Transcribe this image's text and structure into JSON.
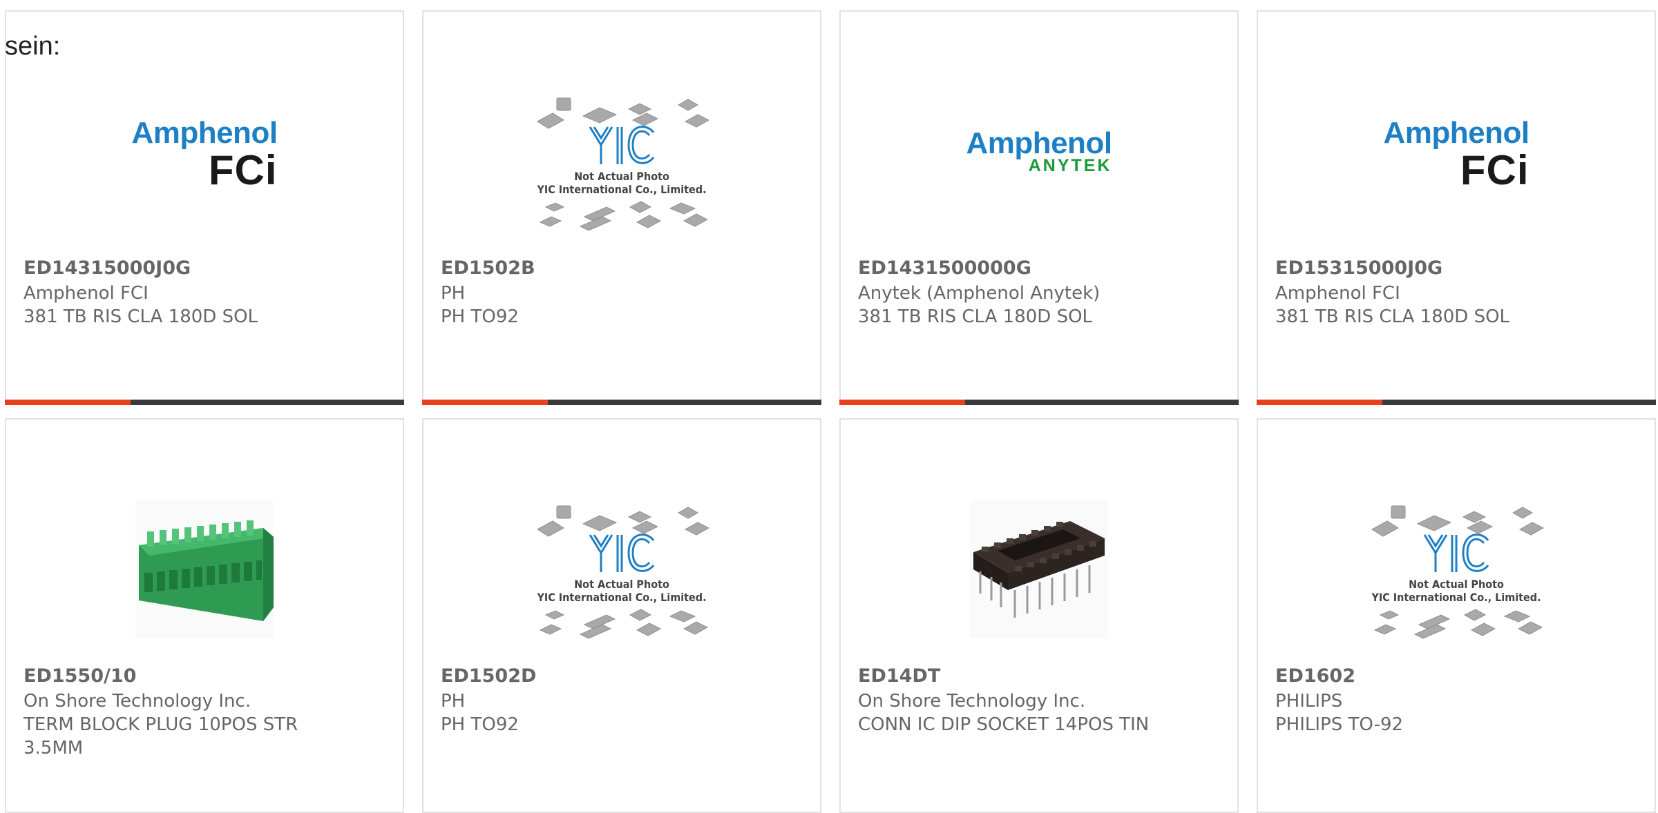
{
  "lead_text": "sein:",
  "colors": {
    "accent": "#e8401c",
    "bar": "#3a3a3a",
    "amphenol_blue": "#1d7fc4",
    "anytek_green": "#1a9a3a"
  },
  "logos": {
    "amphenol": "Amphenol",
    "fci": "FCi",
    "anytek": "ANYTEK"
  },
  "placeholder": {
    "line1": "Not Actual Photo",
    "line2": "YIC International Co., Limited.",
    "mark": "YIC"
  },
  "products": [
    {
      "part_number": "ED14315000J0G",
      "manufacturer": "Amphenol FCI",
      "description": "381 TB RIS CLA 180D SOL",
      "image": "amphenol-fci-logo"
    },
    {
      "part_number": "ED1502B",
      "manufacturer": "PH",
      "description": "PH TO92",
      "image": "yic-placeholder"
    },
    {
      "part_number": "ED1431500000G",
      "manufacturer": "Anytek (Amphenol Anytek)",
      "description": "381 TB RIS CLA 180D SOL",
      "image": "amphenol-anytek-logo"
    },
    {
      "part_number": "ED15315000J0G",
      "manufacturer": "Amphenol FCI",
      "description": "381 TB RIS CLA 180D SOL",
      "image": "amphenol-fci-logo"
    },
    {
      "part_number": "ED1550/10",
      "manufacturer": "On Shore Technology Inc.",
      "description": "TERM BLOCK PLUG 10POS STR 3.5MM",
      "image": "terminal-block-photo"
    },
    {
      "part_number": "ED1502D",
      "manufacturer": "PH",
      "description": "PH TO92",
      "image": "yic-placeholder"
    },
    {
      "part_number": "ED14DT",
      "manufacturer": "On Shore Technology Inc.",
      "description": "CONN IC DIP SOCKET 14POS TIN",
      "image": "dip-socket-photo"
    },
    {
      "part_number": "ED1602",
      "manufacturer": "PHILIPS",
      "description": "PHILIPS TO-92",
      "image": "yic-placeholder"
    }
  ]
}
